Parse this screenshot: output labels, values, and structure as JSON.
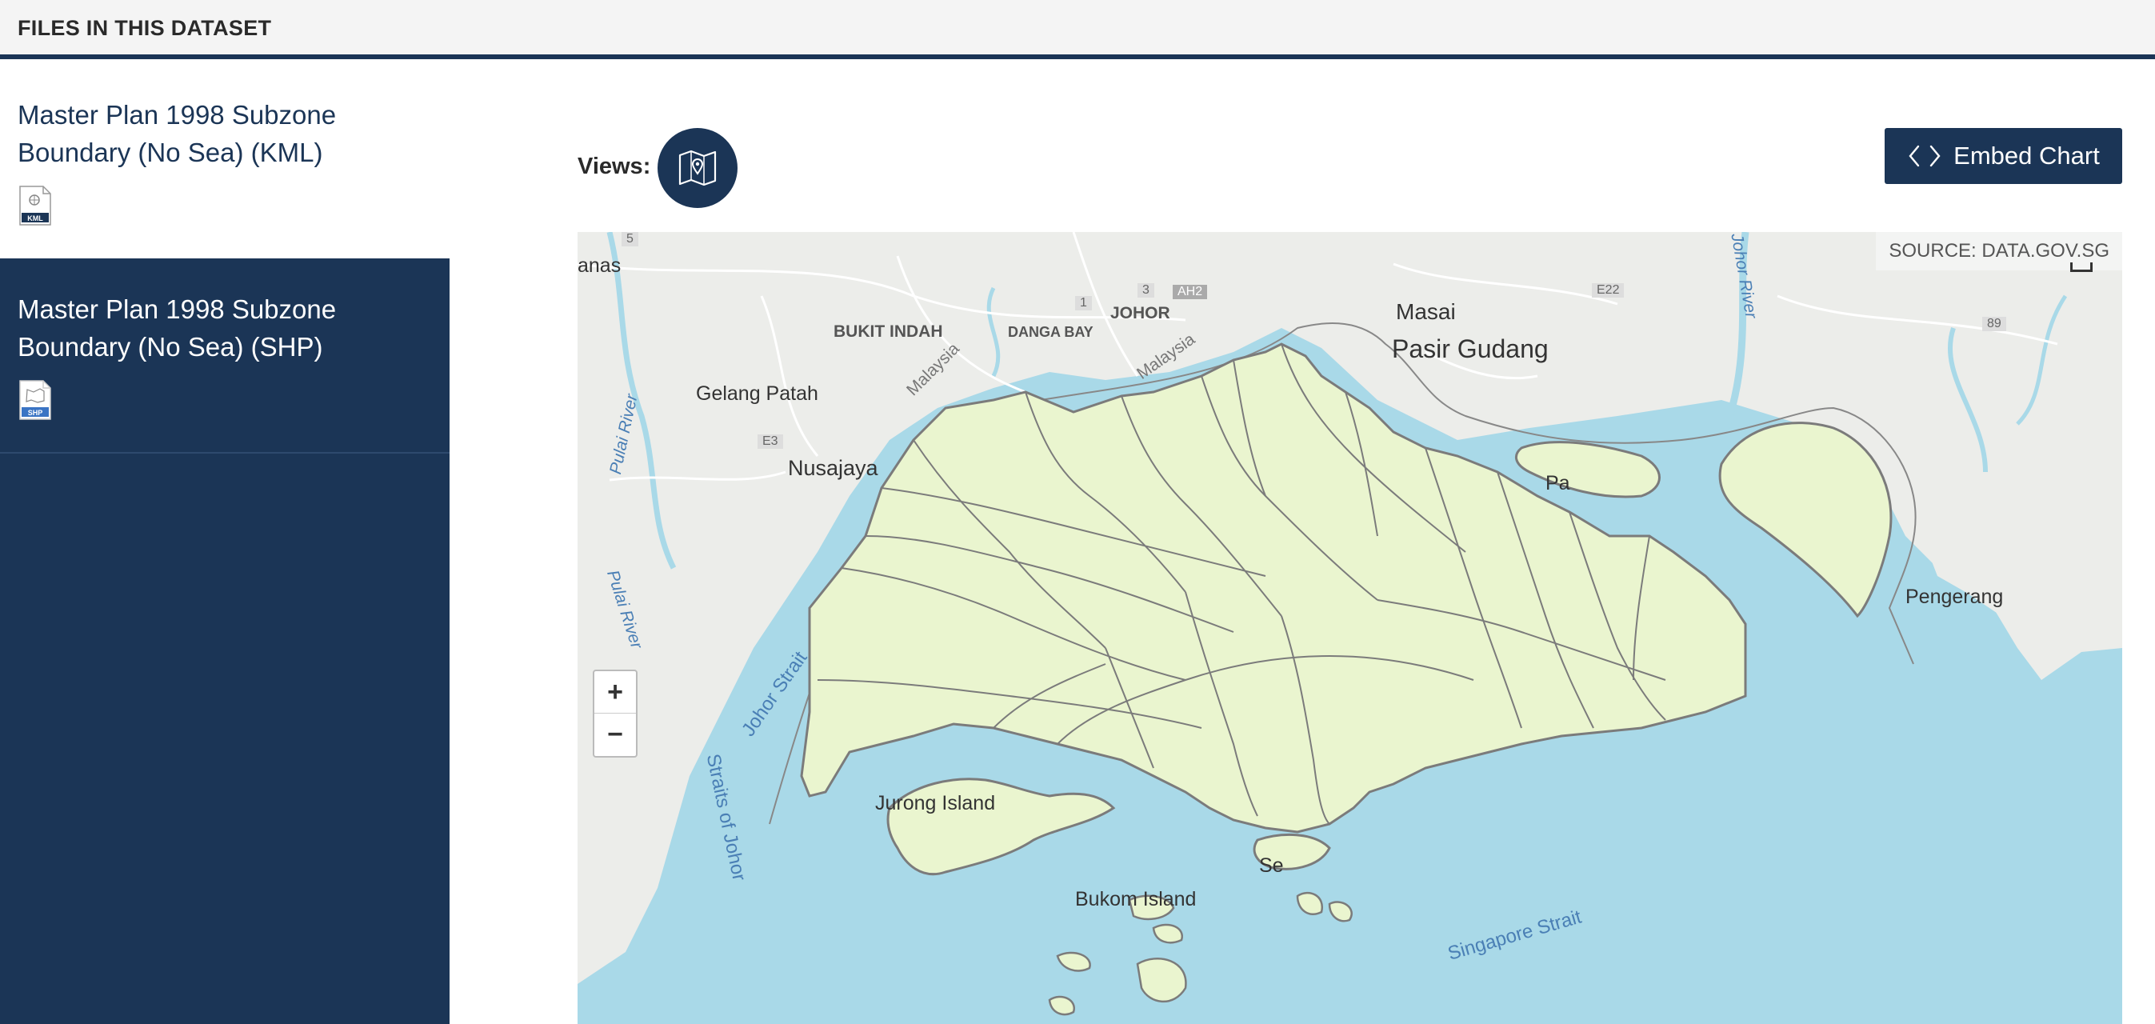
{
  "header": {
    "title": "FILES IN THIS DATASET"
  },
  "files": [
    {
      "title": "Master Plan 1998 Subzone Boundary (No Sea) (KML)",
      "badge": "KML",
      "active": false
    },
    {
      "title": "Master Plan 1998 Subzone Boundary (No Sea) (SHP)",
      "badge": "SHP",
      "active": true
    }
  ],
  "views": {
    "label": "Views:",
    "icon": "map-icon"
  },
  "embed": {
    "label": "Embed Chart",
    "icon": "code-brackets-icon"
  },
  "map": {
    "source": "SOURCE: DATA.GOV.SG",
    "zoom_in": "+",
    "zoom_out": "−",
    "colors": {
      "land": "#ecedea",
      "water": "#a9d9e8",
      "subzone_fill": "#eaf5cf",
      "subzone_stroke": "#7b7b7b"
    },
    "places": {
      "anas": "anas",
      "bukit_indah": "BUKIT INDAH",
      "danga_bay": "DANGA BAY",
      "johor": "JOHOR",
      "masai": "Masai",
      "pasir_gudang": "Pasir Gudang",
      "gelang_patah": "Gelang Patah",
      "nusajaya": "Nusajaya",
      "pulai_river_1": "Pulai River",
      "pulai_river_2": "Pulai River",
      "johor_strait": "Johor Strait",
      "straits_of_johor": "Straits of Johor",
      "johor_river": "Johor River",
      "pengerang": "Pengerang",
      "singapore_strait": "Singapore Strait",
      "malaysia_1": "Malaysia",
      "malaysia_2": "Malaysia",
      "jurong_island": "Jurong Island",
      "bukom_island": "Bukom Island",
      "sentosa": "Se",
      "pa": "Pa",
      "road_5": "5",
      "road_1": "1",
      "road_3": "3",
      "road_ah2": "AH2",
      "road_e3": "E3",
      "road_e22": "E22",
      "road_89": "89"
    }
  }
}
